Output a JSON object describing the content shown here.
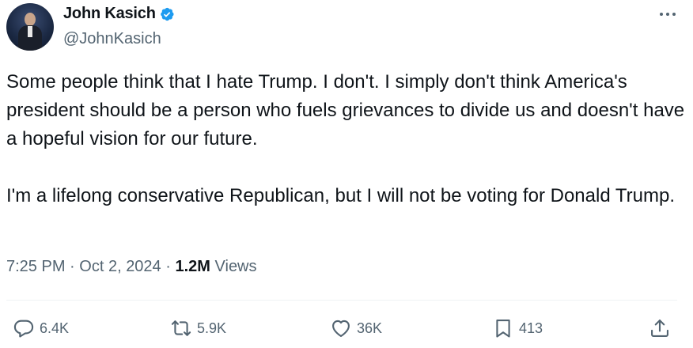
{
  "author": {
    "display_name": "John Kasich",
    "handle": "@JohnKasich",
    "verified": true
  },
  "tweet": {
    "paragraphs": [
      "Some people think that I hate Trump. I don't. I simply don't think America's president should be a person who fuels grievances to divide us and doesn't have a hopeful vision for our future.",
      "I'm a lifelong conservative Republican, but I will not be voting for Donald Trump."
    ],
    "time": "7:25 PM",
    "separator": "·",
    "date": "Oct 2, 2024",
    "views_count": "1.2M",
    "views_label": "Views"
  },
  "actions": {
    "replies": "6.4K",
    "reposts": "5.9K",
    "likes": "36K",
    "bookmarks": "413"
  },
  "icons": {
    "more": "more-horizontal-icon",
    "verified": "verified-badge-icon",
    "reply": "reply-icon",
    "repost": "repost-icon",
    "like": "heart-icon",
    "bookmark": "bookmark-icon",
    "share": "share-icon"
  },
  "colors": {
    "text": "#0f1419",
    "secondary": "#536471",
    "verified": "#1d9bf0"
  }
}
